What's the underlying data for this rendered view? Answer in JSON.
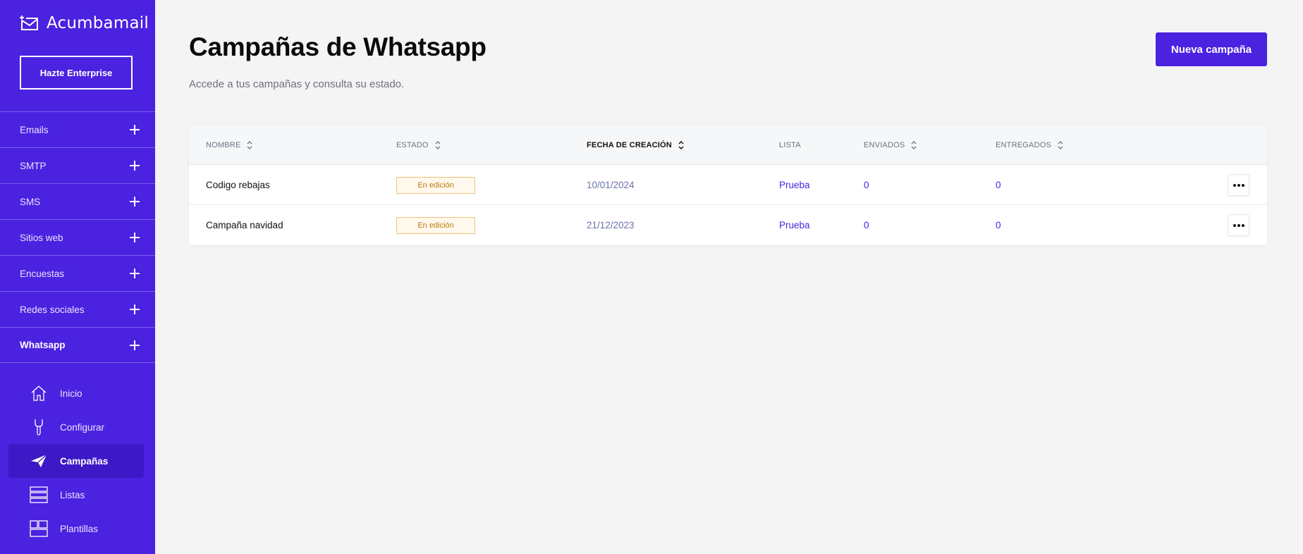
{
  "sidebar": {
    "brand": "Acumbamail",
    "enterprise_button": "Hazte Enterprise",
    "sections": [
      {
        "label": "Emails",
        "active": false
      },
      {
        "label": "SMTP",
        "active": false
      },
      {
        "label": "SMS",
        "active": false
      },
      {
        "label": "Sitios web",
        "active": false
      },
      {
        "label": "Encuestas",
        "active": false
      },
      {
        "label": "Redes sociales",
        "active": false
      },
      {
        "label": "Whatsapp",
        "active": true
      }
    ],
    "subitems": [
      {
        "label": "Inicio",
        "icon": "home-icon"
      },
      {
        "label": "Configurar",
        "icon": "wrench-icon"
      },
      {
        "label": "Campañas",
        "icon": "paper-plane-icon",
        "active": true
      },
      {
        "label": "Listas",
        "icon": "list-icon"
      },
      {
        "label": "Plantillas",
        "icon": "template-icon"
      }
    ]
  },
  "header": {
    "title": "Campañas de Whatsapp",
    "subtitle": "Accede a tus campañas y consulta su estado.",
    "new_button": "Nueva campaña"
  },
  "table": {
    "columns": [
      "NOMBRE",
      "ESTADO",
      "FECHA DE CREACIÓN",
      "LISTA",
      "ENVIADOS",
      "ENTREGADOS"
    ],
    "rows": [
      {
        "name": "Codigo rebajas",
        "status": "En edición",
        "date": "10/01/2024",
        "list": "Prueba",
        "sent": "0",
        "delivered": "0"
      },
      {
        "name": "Campaña navidad",
        "status": "En edición",
        "date": "21/12/2023",
        "list": "Prueba",
        "sent": "0",
        "delivered": "0"
      }
    ]
  },
  "colors": {
    "primary": "#4a22e0",
    "background": "#f4f4f4",
    "badge_text": "#c17a0b"
  }
}
